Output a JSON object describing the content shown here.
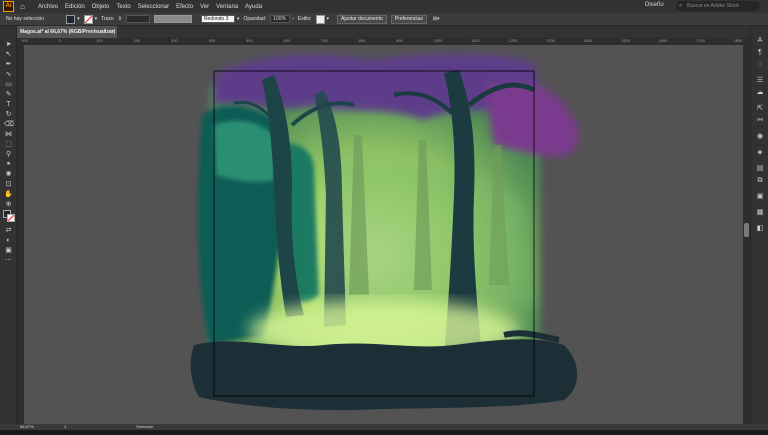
{
  "menubar": {
    "logo": "Ai",
    "items": [
      "Archivo",
      "Edición",
      "Objeto",
      "Texto",
      "Seleccionar",
      "Efecto",
      "Ver",
      "Ventana",
      "Ayuda"
    ],
    "workspace": "Diseño",
    "search_placeholder": "Buscar en Adobe Stock"
  },
  "control_bar": {
    "selection_label": "No hay selección",
    "stroke_label": "Trazo",
    "brush_label": "Redondo 3",
    "opacity_label": "Opacidad:",
    "opacity_value": "100%",
    "style_label": "Estilo:",
    "adjust_button": "Ajustar documento",
    "prefs_button": "Preferencias"
  },
  "document_tab": {
    "title": "Magos.ai* al 66,67% (RGB/Previsualizar)",
    "close": "×"
  },
  "ruler": {
    "ticks": [
      "100",
      "0",
      "100",
      "200",
      "300",
      "400",
      "500",
      "600",
      "700",
      "800",
      "900",
      "1000",
      "1100",
      "1200",
      "1300",
      "1400",
      "1500",
      "1600",
      "1700",
      "1800"
    ]
  },
  "status": {
    "zoom": "66,67%",
    "page": "1",
    "tool": "Selección"
  },
  "colors": {
    "fill": "#1f2733",
    "stroke": "#ff3333",
    "canvas_bg": "#535353",
    "artboard_border": "#000000"
  }
}
